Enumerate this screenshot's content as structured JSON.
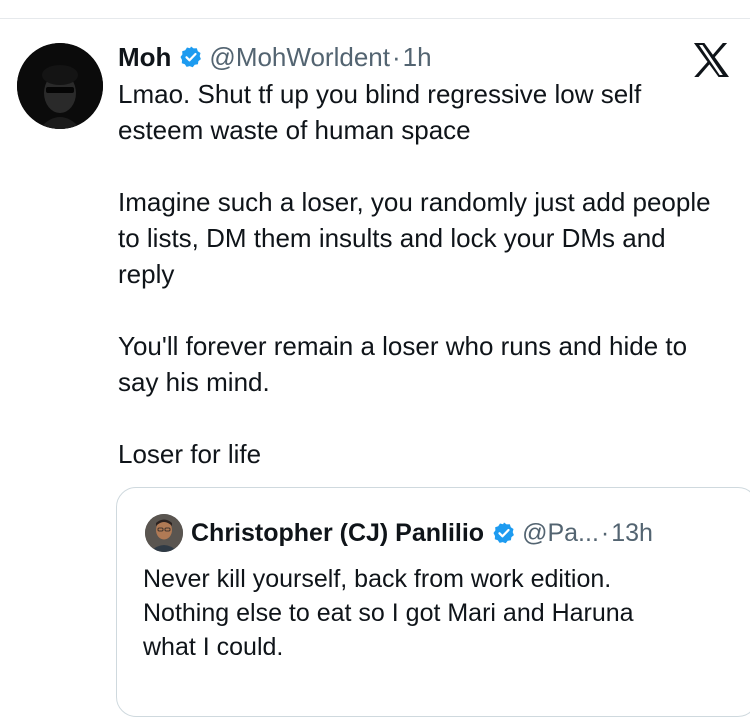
{
  "tweet": {
    "author_name": "Moh",
    "handle": "@MohWorldent",
    "separator": "·",
    "time": "1h",
    "paragraphs": [
      "Lmao. Shut tf up you blind regressive low self esteem waste of human space",
      "Imagine such a loser, you randomly just add people to lists, DM them insults and lock your DMs and reply",
      "You'll forever remain a loser who runs and hide to say his mind.",
      "Loser for life"
    ]
  },
  "quoted_tweet": {
    "author_name": "Christopher (CJ) Panlilio",
    "handle": "@Pa...",
    "separator": "·",
    "time": "13h",
    "text": "Never kill yourself, back from work edition.\nNothing else to eat so I got Mari and Haruna\nwhat I could."
  },
  "icons": {
    "brand_logo": "x-logo-icon",
    "verified": "verified-badge-icon"
  },
  "colors": {
    "text": "#0f1419",
    "muted": "#536471",
    "verified": "#1d9bf0",
    "border": "#cfd9de"
  }
}
